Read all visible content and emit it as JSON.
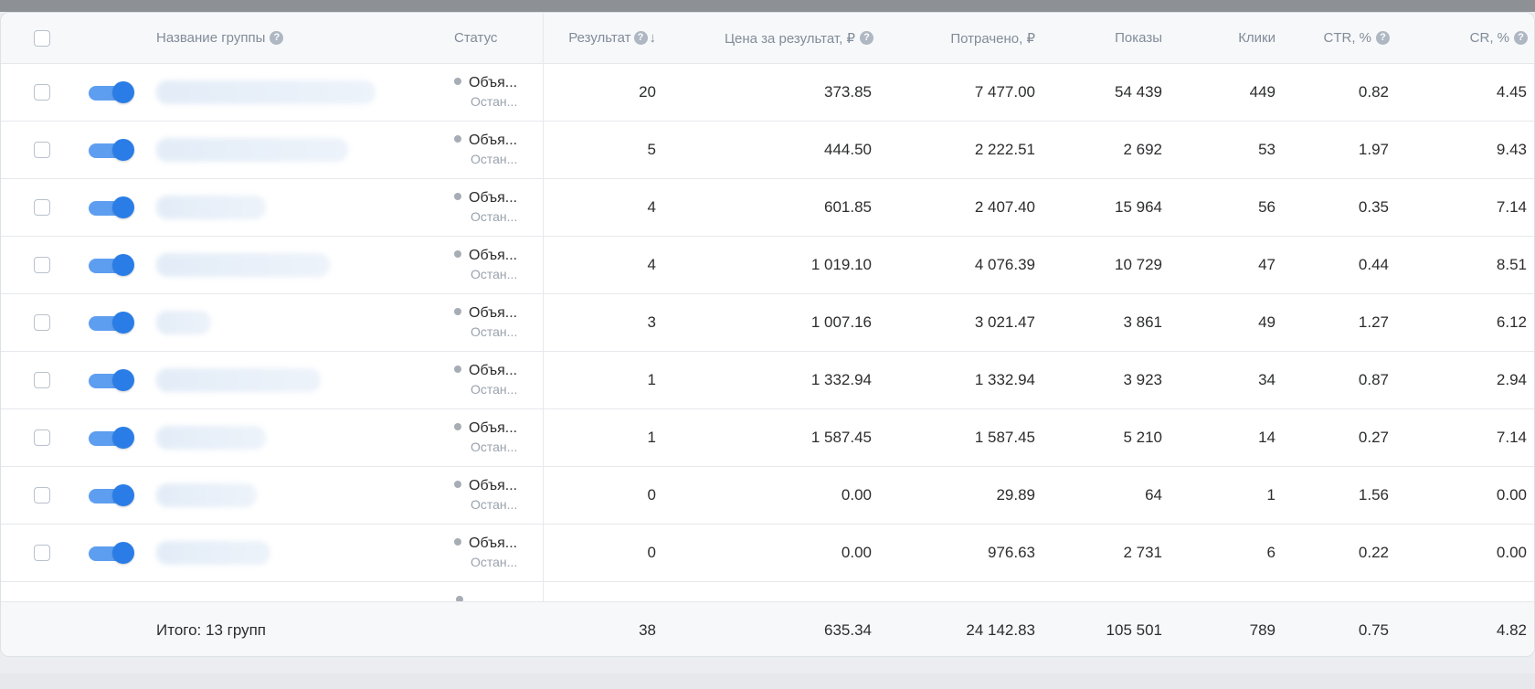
{
  "colors": {
    "accent": "#2a7de7",
    "toggle_track": "#5e9ef0",
    "muted": "#818c99",
    "status_dot": "#a6adb5"
  },
  "header": {
    "name": "Название группы",
    "status": "Статус",
    "result": "Результат",
    "sort_arrow": "↓",
    "price": "Цена за результат, ₽",
    "spent": "Потрачено, ₽",
    "impressions": "Показы",
    "clicks": "Клики",
    "ctr": "CTR, %",
    "cr": "CR, %",
    "help_glyph": "?"
  },
  "rows": [
    {
      "status_main": "Объя...",
      "status_sub": "Остан...",
      "result": "20",
      "price": "373.85",
      "spent": "7 477.00",
      "impressions": "54 439",
      "clicks": "449",
      "ctr": "0.82",
      "cr": "4.45",
      "enabled": true
    },
    {
      "status_main": "Объя...",
      "status_sub": "Остан...",
      "result": "5",
      "price": "444.50",
      "spent": "2 222.51",
      "impressions": "2 692",
      "clicks": "53",
      "ctr": "1.97",
      "cr": "9.43",
      "enabled": true
    },
    {
      "status_main": "Объя...",
      "status_sub": "Остан...",
      "result": "4",
      "price": "601.85",
      "spent": "2 407.40",
      "impressions": "15 964",
      "clicks": "56",
      "ctr": "0.35",
      "cr": "7.14",
      "enabled": true
    },
    {
      "status_main": "Объя...",
      "status_sub": "Остан...",
      "result": "4",
      "price": "1 019.10",
      "spent": "4 076.39",
      "impressions": "10 729",
      "clicks": "47",
      "ctr": "0.44",
      "cr": "8.51",
      "enabled": true
    },
    {
      "status_main": "Объя...",
      "status_sub": "Остан...",
      "result": "3",
      "price": "1 007.16",
      "spent": "3 021.47",
      "impressions": "3 861",
      "clicks": "49",
      "ctr": "1.27",
      "cr": "6.12",
      "enabled": true
    },
    {
      "status_main": "Объя...",
      "status_sub": "Остан...",
      "result": "1",
      "price": "1 332.94",
      "spent": "1 332.94",
      "impressions": "3 923",
      "clicks": "34",
      "ctr": "0.87",
      "cr": "2.94",
      "enabled": true
    },
    {
      "status_main": "Объя...",
      "status_sub": "Остан...",
      "result": "1",
      "price": "1 587.45",
      "spent": "1 587.45",
      "impressions": "5 210",
      "clicks": "14",
      "ctr": "0.27",
      "cr": "7.14",
      "enabled": true
    },
    {
      "status_main": "Объя...",
      "status_sub": "Остан...",
      "result": "0",
      "price": "0.00",
      "spent": "29.89",
      "impressions": "64",
      "clicks": "1",
      "ctr": "1.56",
      "cr": "0.00",
      "enabled": true
    },
    {
      "status_main": "Объя...",
      "status_sub": "Остан...",
      "result": "0",
      "price": "0.00",
      "spent": "976.63",
      "impressions": "2 731",
      "clicks": "6",
      "ctr": "0.22",
      "cr": "0.00",
      "enabled": true
    }
  ],
  "total": {
    "label": "Итого: 13 групп",
    "result": "38",
    "price": "635.34",
    "spent": "24 142.83",
    "impressions": "105 501",
    "clicks": "789",
    "ctr": "0.75",
    "cr": "4.82"
  }
}
